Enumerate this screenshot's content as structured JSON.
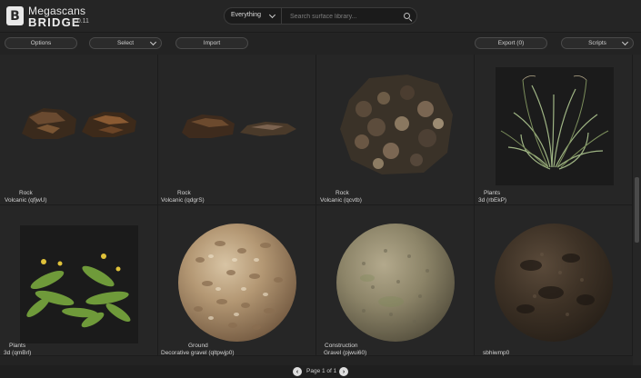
{
  "app": {
    "name_line1": "Megascans",
    "name_line2": "BRIDGE",
    "version": "1.0.11",
    "logo_letter": "B"
  },
  "search": {
    "filter_value": "Everything",
    "placeholder": "Search surface library..."
  },
  "toolbar": {
    "options_label": "Options",
    "select_label": "Select",
    "import_label": "Import",
    "export_label": "Export (0)",
    "scripts_label": "Scripts"
  },
  "assets": [
    {
      "category": "Rock",
      "name": "Volcanic (qfjwU)"
    },
    {
      "category": "Rock",
      "name": "Volcanic (qdgrS)"
    },
    {
      "category": "Rock",
      "name": "Volcanic (qcvtb)"
    },
    {
      "category": "Plants",
      "name": "3d (rbEkP)"
    },
    {
      "category": "Plants",
      "name": "3d (qmBrl)"
    },
    {
      "category": "Ground",
      "name": "Decorative gravel (qltpwjp0)"
    },
    {
      "category": "Construction",
      "name": "Gravel (pjwui60)"
    },
    {
      "category": "",
      "name": "sbhiwmp0"
    }
  ],
  "pager": {
    "label": "Page 1 of 1"
  },
  "colors": {
    "background": "#232323",
    "panel": "#262626",
    "text": "#d8d8d8"
  }
}
